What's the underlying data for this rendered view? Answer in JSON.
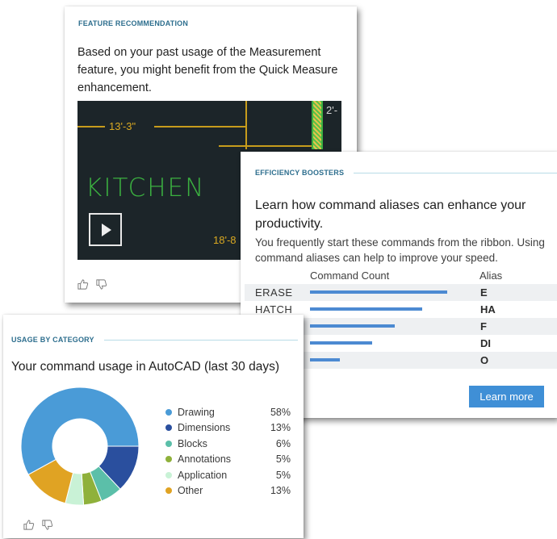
{
  "feature_card": {
    "eyebrow": "FEATURE RECOMMENDATION",
    "description": "Based on your past usage of the Measurement feature, you might benefit from the Quick Measure enhancement.",
    "video": {
      "dim_left": "13'-3\"",
      "dim_top_right": "2'-",
      "dim_bottom_right": "18'-8",
      "room_label": "KITCHEN",
      "play_icon": "play-icon"
    }
  },
  "efficiency_card": {
    "eyebrow": "EFFICIENCY BOOSTERS",
    "title": "Learn how command aliases can enhance your productivity.",
    "subtitle": "You frequently start these commands from the ribbon. Using command aliases can help to improve your speed.",
    "col_count": "Command Count",
    "col_alias": "Alias",
    "rows": [
      {
        "command": "ERASE",
        "count": 1.0,
        "alias": "E"
      },
      {
        "command": "HATCH",
        "count": 0.82,
        "alias": "HA"
      },
      {
        "command": "",
        "count": 0.62,
        "alias": "F"
      },
      {
        "command": "",
        "count": 0.45,
        "alias": "DI"
      },
      {
        "command": "",
        "count": 0.22,
        "alias": "O"
      }
    ],
    "learn_more": "Learn more",
    "accent": "#3f8fd6"
  },
  "usage_card": {
    "eyebrow": "USAGE BY CATEGORY",
    "title": "Your command usage in AutoCAD (last 30 days)",
    "chart_data": {
      "type": "pie",
      "categories": [
        "Drawing",
        "Dimensions",
        "Blocks",
        "Annotations",
        "Application",
        "Other"
      ],
      "values": [
        58,
        13,
        6,
        5,
        5,
        13
      ],
      "labels": [
        "58%",
        "13%",
        "6%",
        "5%",
        "5%",
        "13%"
      ],
      "colors": [
        "#4a9bd7",
        "#2a4f9e",
        "#5bbfa9",
        "#8fb13b",
        "#c9f2d6",
        "#e0a323"
      ]
    }
  },
  "feedback": {
    "like_icon": "thumbs-up-icon",
    "dislike_icon": "thumbs-down-icon"
  }
}
